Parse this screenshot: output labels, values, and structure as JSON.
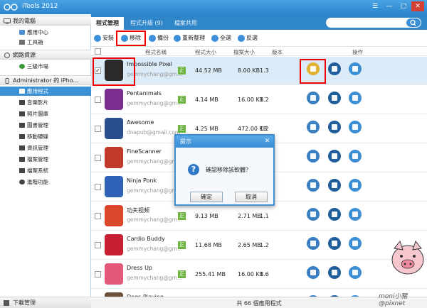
{
  "app": {
    "title": "iTools 2012",
    "window_buttons": [
      "☰",
      "—",
      "□",
      "✕"
    ]
  },
  "top_tabs": [
    {
      "label": "程式管理",
      "active": true
    },
    {
      "label": "程式升級 (9)",
      "active": false
    },
    {
      "label": "檔案共用",
      "active": false
    }
  ],
  "search": {
    "placeholder": ""
  },
  "sidebar": {
    "sections": [
      {
        "label": "我的電腦",
        "items": [
          "應用中心",
          "工具箱"
        ]
      },
      {
        "label": "網路資源",
        "items": [
          "三級市場"
        ]
      },
      {
        "label": "Administrator 的 iPho...",
        "items": [
          "應用程式",
          "音樂影片",
          "照片圖庫",
          "圖書管理",
          "移動硬碟",
          "資訊管理",
          "檔案管理",
          "檔案系統",
          "進階功能"
        ]
      }
    ],
    "active_item": "應用程式",
    "footer": "下載管理"
  },
  "toolbar": {
    "install": "安裝",
    "remove": "移除",
    "backup": "備份",
    "reorganize": "重新整理",
    "select_all": "全選",
    "invert": "反選"
  },
  "table": {
    "headers": [
      "程式名稱",
      "程式大小",
      "檔案大小",
      "版本",
      "操作"
    ],
    "rows": [
      {
        "name": "Impossible Pixel",
        "dev": "gemmychang@gm...",
        "badge": "正",
        "size": "44.52 MB",
        "fsize": "8.00 KB",
        "ver": "1.3",
        "checked": true
      },
      {
        "name": "Pentanimals",
        "dev": "gemmychang@gm...",
        "badge": "正",
        "size": "4.14 MB",
        "fsize": "16.00 KB",
        "ver": "1.2",
        "checked": false
      },
      {
        "name": "Awesome",
        "dev": "dnapub@gmail.com",
        "badge": "正",
        "size": "4.25 MB",
        "fsize": "472.00 KB",
        "ver": "1.2",
        "checked": false
      },
      {
        "name": "FineScanner",
        "dev": "gemmychang@gm...",
        "badge": "",
        "size": "",
        "fsize": "",
        "ver": "",
        "checked": false
      },
      {
        "name": "Ninja Ponk",
        "dev": "gemmychang@gm...",
        "badge": "",
        "size": "",
        "fsize": "",
        "ver": "",
        "checked": false
      },
      {
        "name": "功夫视频",
        "dev": "gemmychang@gm...",
        "badge": "正",
        "size": "9.13 MB",
        "fsize": "2.71 MB",
        "ver": "1.1",
        "checked": false
      },
      {
        "name": "Cardio Buddy",
        "dev": "gemmychang@gm...",
        "badge": "正",
        "size": "11.68 MB",
        "fsize": "2.65 MB",
        "ver": "1.2",
        "checked": false
      },
      {
        "name": "Dress Up",
        "dev": "gemmychang@gm...",
        "badge": "正",
        "size": "255.41 MB",
        "fsize": "16.00 KB",
        "ver": "1.6",
        "checked": false
      },
      {
        "name": "Dogs Playing",
        "dev": "",
        "badge": "",
        "size": "",
        "fsize": "",
        "ver": "",
        "checked": false
      }
    ]
  },
  "status": "共 66 個應用程式",
  "dialog": {
    "title": "提示",
    "message": "確認移除該軟體？",
    "ok": "確定",
    "cancel": "取消",
    "icon": "question-icon"
  },
  "watermark": "moni小豬@pixnet"
}
